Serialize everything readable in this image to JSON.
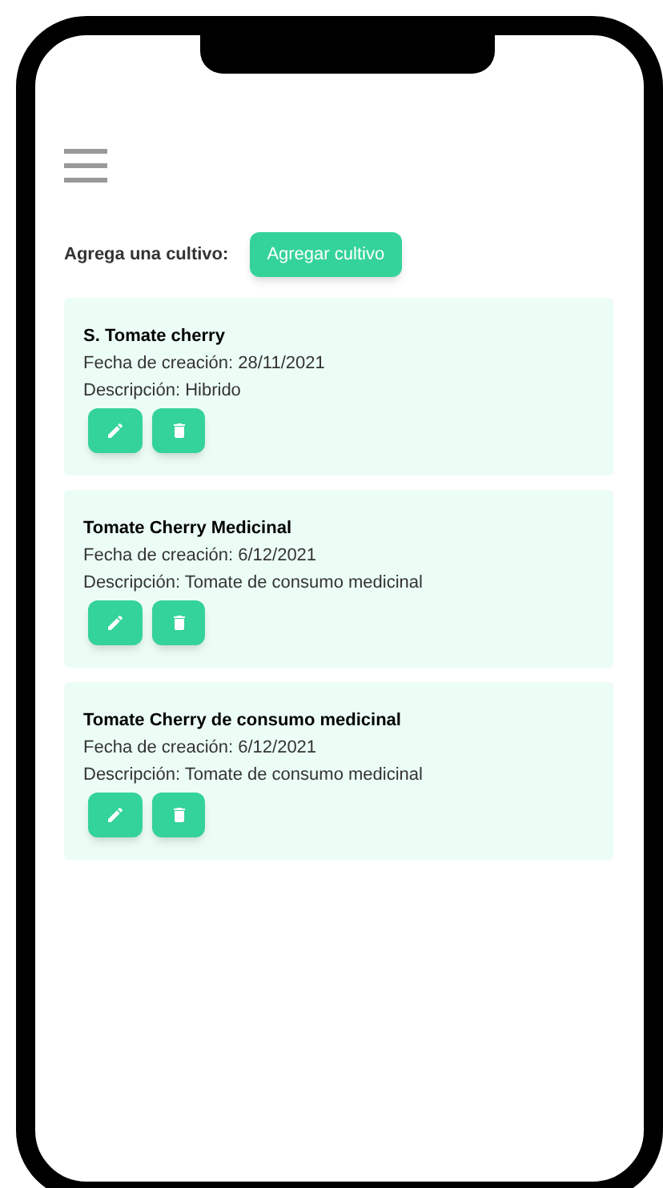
{
  "header": {
    "add_label": "Agrega una cultivo:",
    "add_button": "Agregar cultivo"
  },
  "crops": [
    {
      "name": "S. Tomate cherry",
      "created": "Fecha de creación: 28/11/2021",
      "description": "Descripción: Hibrido"
    },
    {
      "name": "Tomate Cherry Medicinal",
      "created": "Fecha de creación: 6/12/2021",
      "description": "Descripción: Tomate de consumo medicinal"
    },
    {
      "name": "Tomate Cherry de consumo medicinal",
      "created": "Fecha de creación: 6/12/2021",
      "description": "Descripción: Tomate de consumo medicinal"
    }
  ]
}
